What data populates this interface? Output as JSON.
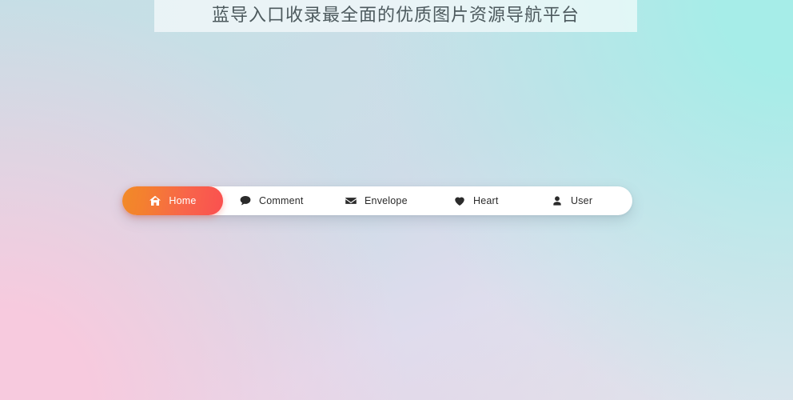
{
  "page": {
    "title": "蓝导入口收录最全面的优质图片资源导航平台",
    "title_color": "#4d5a5e",
    "background_colors": {
      "top_left": "#c5dfe6",
      "top_right": "#a6ede8",
      "bottom_left": "#f7cade",
      "bottom_right": "#dde4ed"
    }
  },
  "nav": {
    "active_gradient_from": "#f18a28",
    "active_gradient_to": "#fa5050",
    "bar_background": "#ffffff",
    "items": [
      {
        "id": "home",
        "label": "Home",
        "icon": "home-icon",
        "active": true
      },
      {
        "id": "comment",
        "label": "Comment",
        "icon": "comment-icon",
        "active": false
      },
      {
        "id": "envelope",
        "label": "Envelope",
        "icon": "envelope-icon",
        "active": false
      },
      {
        "id": "heart",
        "label": "Heart",
        "icon": "heart-icon",
        "active": false
      },
      {
        "id": "user",
        "label": "User",
        "icon": "user-icon",
        "active": false
      }
    ]
  }
}
